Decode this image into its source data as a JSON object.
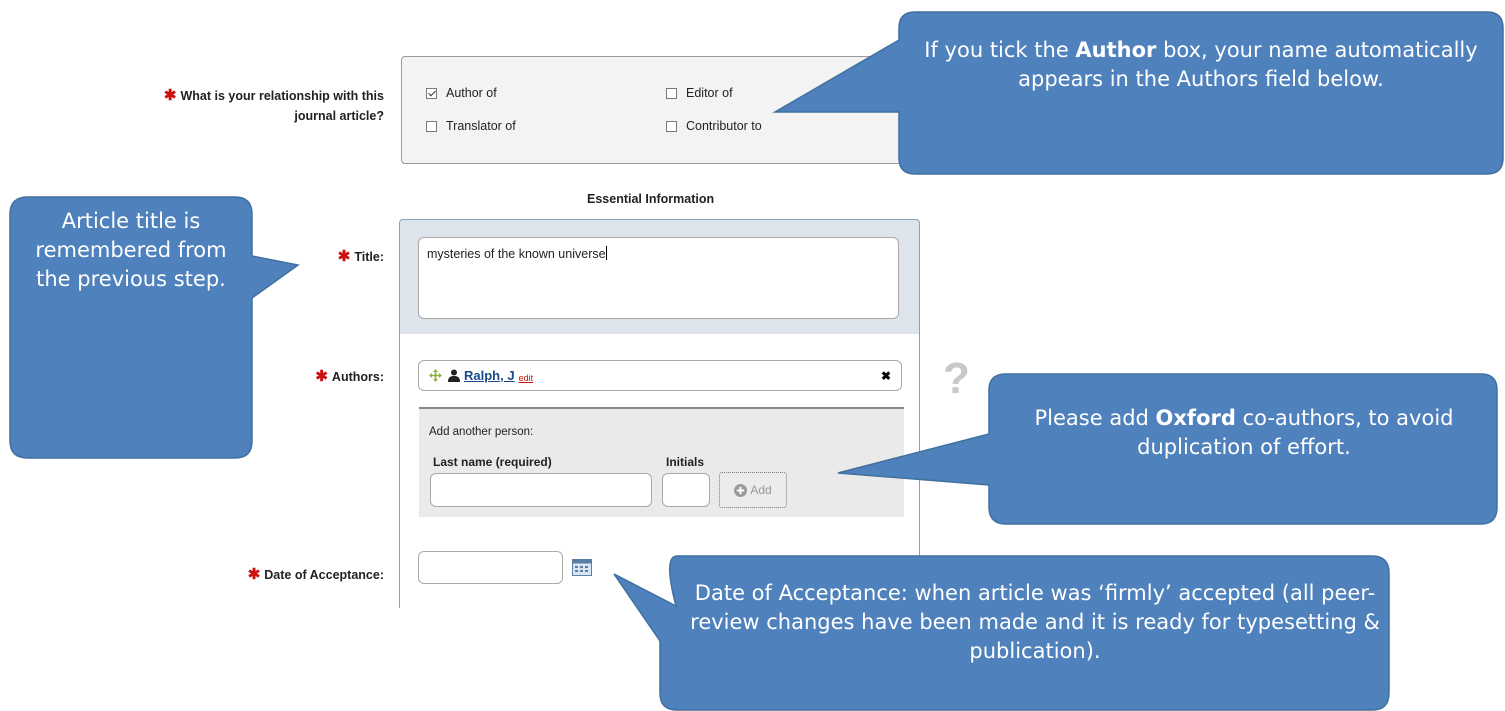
{
  "relationship": {
    "question_line1": "What is your relationship with this",
    "question_line2": "journal article?",
    "options": [
      {
        "label": "Author of",
        "checked": true
      },
      {
        "label": "Editor of",
        "checked": false
      },
      {
        "label": "Translator of",
        "checked": false
      },
      {
        "label": "Contributor to",
        "checked": false
      }
    ]
  },
  "section_heading": "Essential Information",
  "title_field": {
    "label": "Title:",
    "value": "mysteries of the known universe"
  },
  "authors_field": {
    "label": "Authors:",
    "author_name": "Ralph, J",
    "edit_link": "edit",
    "remove_symbol": "✖"
  },
  "add_person": {
    "heading": "Add another person:",
    "last_name_label": "Last name (required)",
    "initials_label": "Initials",
    "add_button": "Add"
  },
  "date_field": {
    "label": "Date of Acceptance:"
  },
  "help_symbol": "?",
  "callouts": {
    "author_box": {
      "pre": "If you tick the ",
      "bold": "Author",
      "post": " box, your name automatically appears in the Authors field below."
    },
    "title": {
      "text": "Article title is remembered from the previous step."
    },
    "coauthors": {
      "pre": "Please add ",
      "bold": "Oxford",
      "post": " co-authors, to avoid duplication of effort."
    },
    "date": {
      "text": "Date of Acceptance: when article was ‘firmly’ accepted (all peer-review changes have been made and it is ready for typesetting & publication)."
    }
  },
  "colors": {
    "callout_fill": "#4f81bd",
    "required_star": "#cc1111",
    "panel_blue": "#dde4ec"
  }
}
